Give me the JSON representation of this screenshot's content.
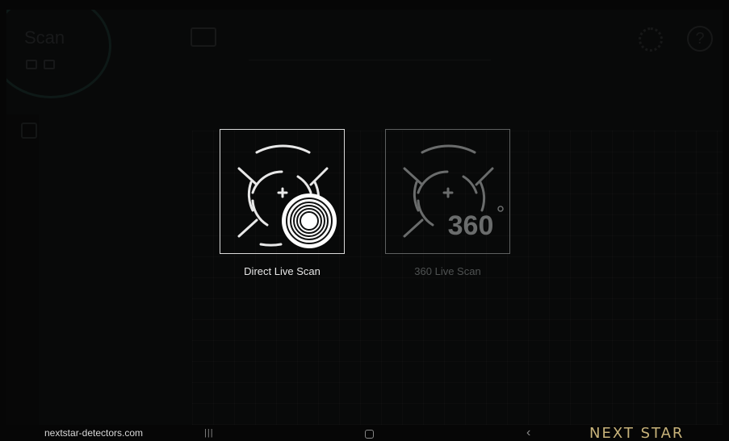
{
  "app": {
    "title": "Scan"
  },
  "modes": [
    {
      "label": "Direct Live Scan",
      "active": true
    },
    {
      "label": "360 Live Scan",
      "active": false,
      "badge": "360"
    }
  ],
  "footer": {
    "website": "nextstar-detectors.com",
    "brand": "NEXT STAR"
  },
  "icons": {
    "top_bar": "image-icon",
    "settings": "gear-icon",
    "help": "help-icon",
    "nav_recent": "recent-apps-icon",
    "nav_home": "home-icon",
    "nav_back": "back-icon"
  },
  "colors": {
    "background": "#101111",
    "active_border": "#d9d9d9",
    "inactive_border": "#5e6060",
    "brand_gold": "#c8b37a"
  }
}
